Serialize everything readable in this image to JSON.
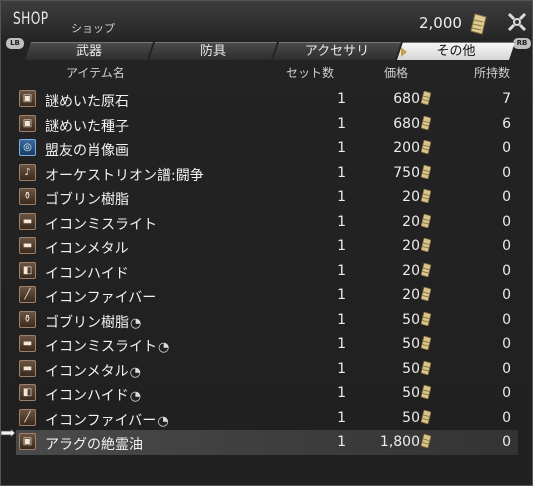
{
  "header": {
    "title": "SHOP",
    "subtitle": "ショップ",
    "gil_total": "2,000",
    "close_icon": "close-cross-icon",
    "lb": "LB",
    "rb": "RB"
  },
  "tabs": [
    {
      "label": "武器",
      "active": false
    },
    {
      "label": "防具",
      "active": false
    },
    {
      "label": "アクセサリ",
      "active": false
    },
    {
      "label": "その他",
      "active": true
    }
  ],
  "columns": {
    "name": "アイテム名",
    "set": "セット数",
    "price": "価格",
    "owned": "所持数"
  },
  "items": [
    {
      "icon": "chest-icon",
      "name": "謎めいた原石",
      "hq": false,
      "set": "1",
      "price": "680",
      "owned": "7"
    },
    {
      "icon": "chest-icon",
      "name": "謎めいた種子",
      "hq": false,
      "set": "1",
      "price": "680",
      "owned": "6"
    },
    {
      "icon": "eye-icon",
      "name": "盟友の肖像画",
      "hq": false,
      "set": "1",
      "price": "200",
      "owned": "0"
    },
    {
      "icon": "music-note-icon",
      "name": "オーケストリオン譜:闘争",
      "hq": false,
      "set": "1",
      "price": "750",
      "owned": "0"
    },
    {
      "icon": "flask-icon",
      "name": "ゴブリン樹脂",
      "hq": false,
      "set": "1",
      "price": "20",
      "owned": "0"
    },
    {
      "icon": "anvil-icon",
      "name": "イコンミスライト",
      "hq": false,
      "set": "1",
      "price": "20",
      "owned": "0"
    },
    {
      "icon": "anvil-icon",
      "name": "イコンメタル",
      "hq": false,
      "set": "1",
      "price": "20",
      "owned": "0"
    },
    {
      "icon": "hide-icon",
      "name": "イコンハイド",
      "hq": false,
      "set": "1",
      "price": "20",
      "owned": "0"
    },
    {
      "icon": "needle-icon",
      "name": "イコンファイバー",
      "hq": false,
      "set": "1",
      "price": "20",
      "owned": "0"
    },
    {
      "icon": "flask-icon",
      "name": "ゴブリン樹脂",
      "hq": true,
      "set": "1",
      "price": "50",
      "owned": "0"
    },
    {
      "icon": "anvil-icon",
      "name": "イコンミスライト",
      "hq": true,
      "set": "1",
      "price": "50",
      "owned": "0"
    },
    {
      "icon": "anvil-icon",
      "name": "イコンメタル",
      "hq": true,
      "set": "1",
      "price": "50",
      "owned": "0"
    },
    {
      "icon": "hide-icon",
      "name": "イコンハイド",
      "hq": true,
      "set": "1",
      "price": "50",
      "owned": "0"
    },
    {
      "icon": "needle-icon",
      "name": "イコンファイバー",
      "hq": true,
      "set": "1",
      "price": "50",
      "owned": "0"
    },
    {
      "icon": "chest-icon",
      "name": "アラグの絶霊油",
      "hq": false,
      "set": "1",
      "price": "1,800",
      "owned": "0",
      "selected": true
    }
  ],
  "colors": {
    "gil": "#d8c48a",
    "selected_row": "#454545"
  }
}
